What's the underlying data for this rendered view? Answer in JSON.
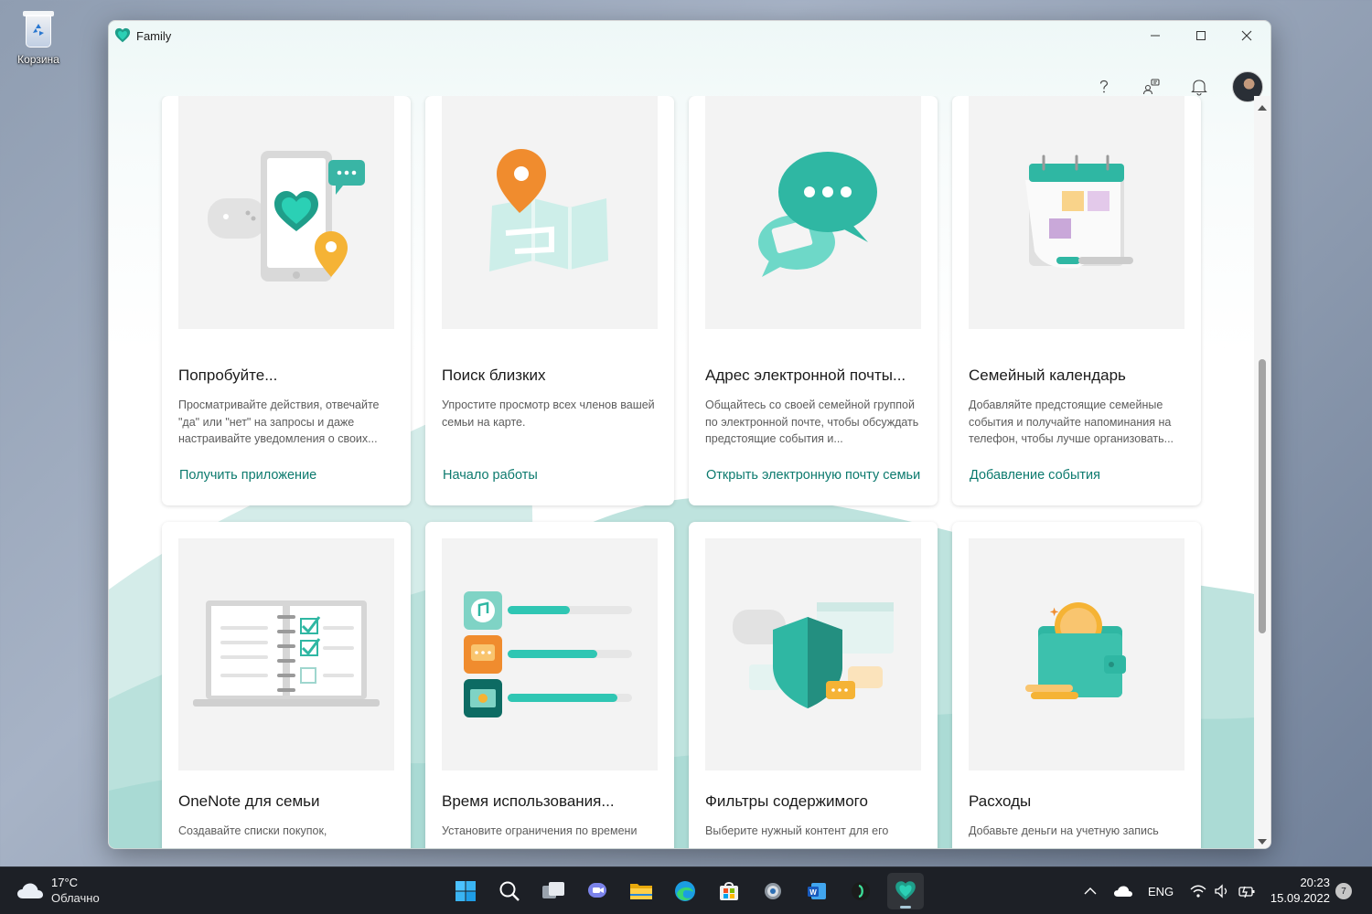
{
  "desktop": {
    "recycle_bin_label": "Корзина"
  },
  "window": {
    "title": "Family"
  },
  "header": {
    "help_icon": "help-icon",
    "family_icon": "family-switch-icon",
    "notifications_icon": "bell-icon"
  },
  "cards": [
    {
      "title": "Попробуйте...",
      "description": "Просматривайте действия, отвечайте \"да\" или \"нет\" на запросы и даже настраивайте уведомления о своих...",
      "link": "Получить приложение"
    },
    {
      "title": "Поиск близких",
      "description": "Упростите просмотр всех членов вашей семьи на карте.",
      "link": "Начало работы"
    },
    {
      "title": "Адрес электронной почты...",
      "description": "Общайтесь со своей семейной группой по электронной почте, чтобы обсуждать предстоящие события и...",
      "link": "Открыть электронную почту семьи"
    },
    {
      "title": "Семейный календарь",
      "description": "Добавляйте предстоящие семейные события и получайте напоминания на телефон, чтобы лучше организовать...",
      "link": "Добавление события"
    },
    {
      "title": "OneNote для семьи",
      "description": "Создавайте списки покупок,",
      "link": ""
    },
    {
      "title": "Время использования...",
      "description": "Установите ограничения по времени",
      "link": ""
    },
    {
      "title": "Фильтры содержимого",
      "description": "Выберите нужный контент для его",
      "link": ""
    },
    {
      "title": "Расходы",
      "description": "Добавьте деньги на учетную запись",
      "link": ""
    }
  ],
  "taskbar": {
    "weather_temp": "17°C",
    "weather_cond": "Облачно",
    "lang": "ENG",
    "time": "20:23",
    "date": "15.09.2022",
    "notifications": "7"
  },
  "colors": {
    "accent": "#0c7a6e",
    "teal": "#3bbfae",
    "orange": "#f08c2e"
  }
}
